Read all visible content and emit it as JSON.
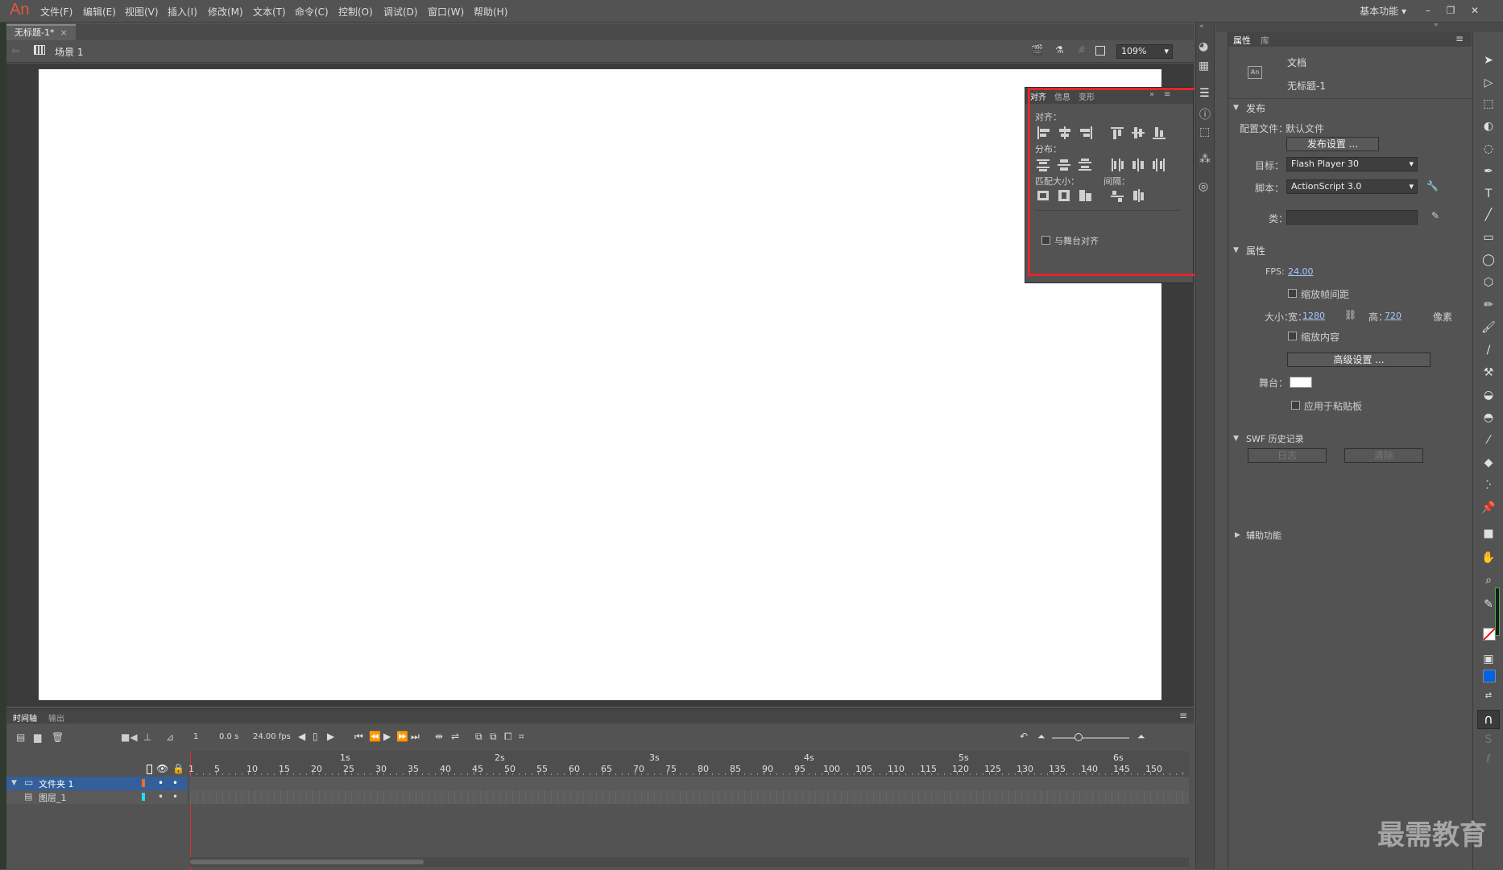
{
  "app": {
    "logo": "An",
    "workspace": "基本功能"
  },
  "menu": [
    "文件(F)",
    "编辑(E)",
    "视图(V)",
    "插入(I)",
    "修改(M)",
    "文本(T)",
    "命令(C)",
    "控制(O)",
    "调试(D)",
    "窗口(W)",
    "帮助(H)"
  ],
  "doc": {
    "tab": "无标题-1*",
    "close": "×",
    "scene": "场景 1",
    "zoom": "109%"
  },
  "align_panel": {
    "tabs": [
      "对齐",
      "信息",
      "变形"
    ],
    "align_label": "对齐：",
    "distribute_label": "分布：",
    "match_label": "匹配大小：",
    "space_label": "间隔：",
    "stage_align": "与舞台对齐"
  },
  "props": {
    "tabs": [
      "属性",
      "库"
    ],
    "doc_type": "文档",
    "doc_name": "无标题-1",
    "publish": {
      "heading": "发布",
      "profile_label": "配置文件：",
      "profile_value": "默认文件",
      "settings_btn": "发布设置 ...",
      "target_label": "目标：",
      "target_value": "Flash Player 30",
      "script_label": "脚本：",
      "script_value": "ActionScript 3.0",
      "class_label": "类："
    },
    "properties": {
      "heading": "属性",
      "fps_label": "FPS:",
      "fps_value": "24.00",
      "scale_spans": "缩放帧间距",
      "size_label": "大小：",
      "width_label": "宽：",
      "width_value": "1280",
      "height_label": "高：",
      "height_value": "720",
      "unit": "像素",
      "scale_content": "缩放内容",
      "advanced_btn": "高级设置 ...",
      "stage_label": "舞台：",
      "apply_pasteboard": "应用于粘贴板"
    },
    "swf": {
      "heading": "SWF 历史记录",
      "log_btn": "日志",
      "clear_btn": "清除"
    },
    "accessibility": {
      "heading": "辅助功能"
    }
  },
  "timeline": {
    "tabs": [
      "时间轴",
      "输出"
    ],
    "frame": "1",
    "time": "0.0 s",
    "fps": "24.00 fps",
    "seconds": [
      "1s",
      "2s",
      "3s",
      "4s",
      "5s",
      "6s"
    ],
    "frame_numbers": [
      "1",
      "5",
      "10",
      "15",
      "20",
      "25",
      "30",
      "35",
      "40",
      "45",
      "50",
      "55",
      "60",
      "65",
      "70",
      "75",
      "80",
      "85",
      "90",
      "95",
      "100",
      "105",
      "110",
      "115",
      "120",
      "125",
      "130",
      "135",
      "140",
      "145",
      "150"
    ],
    "layers": [
      {
        "name": "文件夹 1",
        "color": "#f07020"
      },
      {
        "name": "图层_1",
        "color": "#20e0f0"
      }
    ]
  },
  "watermark": "最需教育"
}
